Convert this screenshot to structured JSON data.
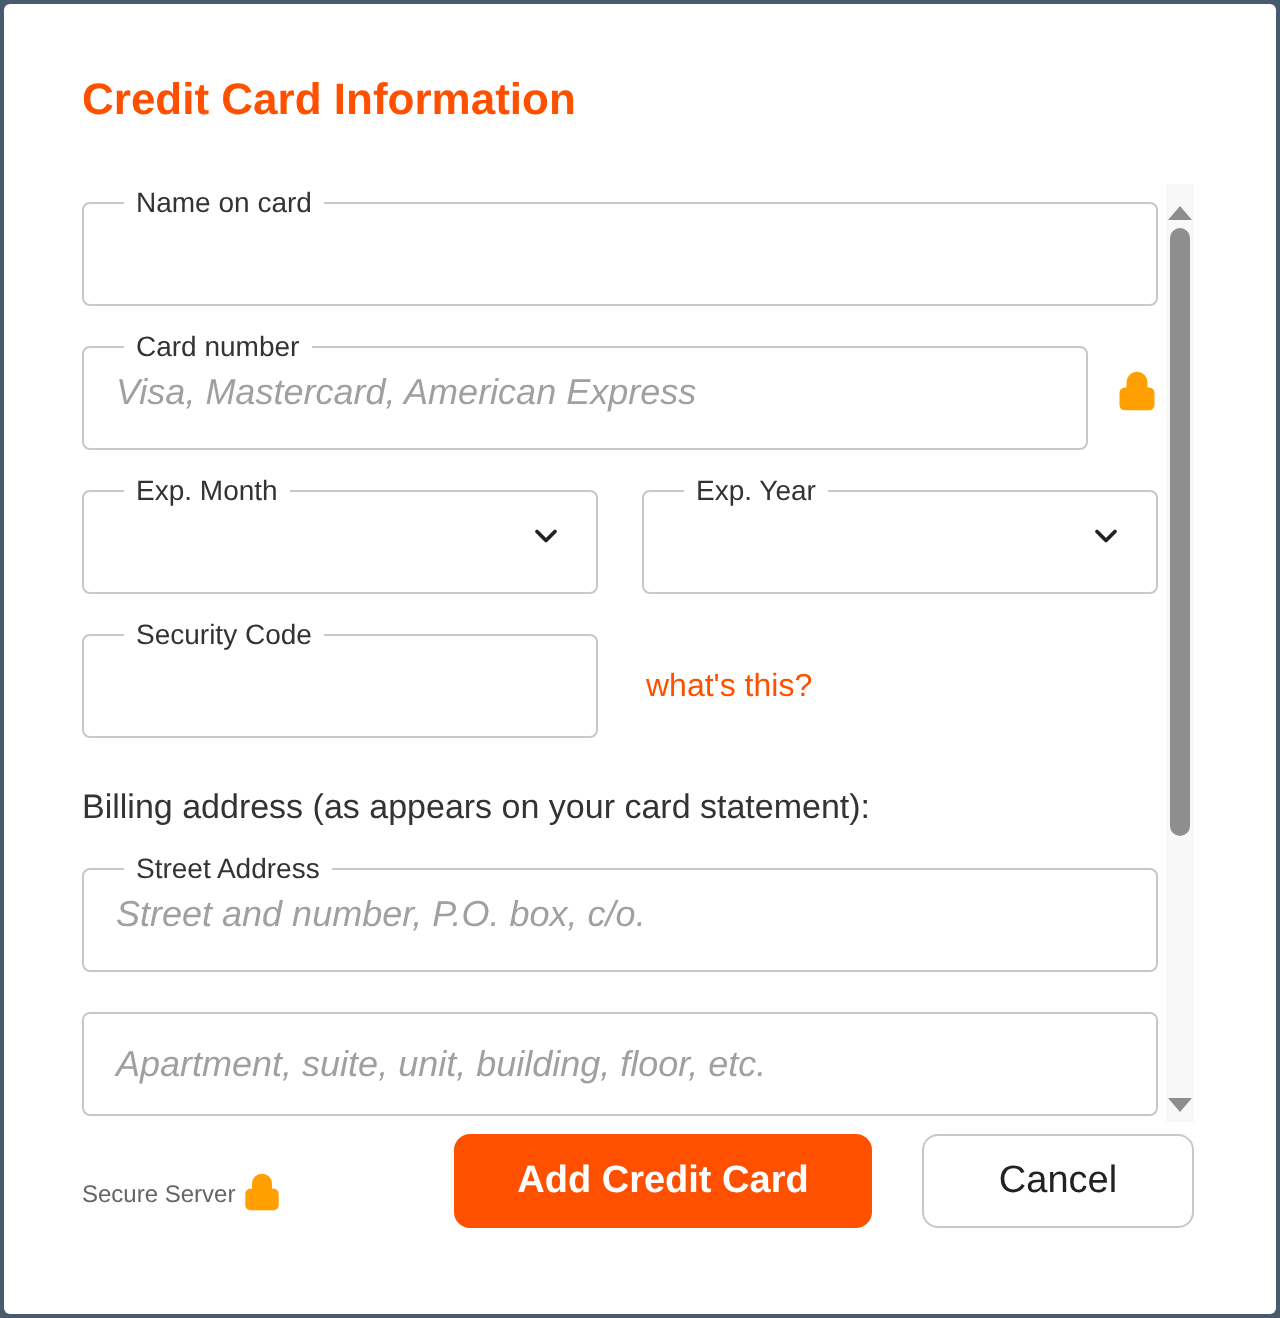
{
  "title": "Credit Card Information",
  "form": [
    {
      "kind": "field",
      "label": "Name on card"
    },
    {
      "kind": "field_lock",
      "label": "Card number",
      "placeholder": "Visa, Mastercard, American Express"
    },
    {
      "kind": "select_pair",
      "selects": [
        {
          "label": "Exp. Month"
        },
        {
          "label": "Exp. Year"
        }
      ]
    },
    {
      "kind": "field_link",
      "label": "Security Code",
      "link": "what's this?"
    },
    {
      "kind": "heading",
      "text": "Billing address (as appears on your card statement):"
    },
    {
      "kind": "field",
      "label": "Street Address",
      "placeholder": "Street and number, P.O. box, c/o."
    },
    {
      "kind": "field",
      "placeholder": "Apartment, suite, unit, building, floor, etc."
    }
  ],
  "secure_note": "Secure Server",
  "buttons": [
    {
      "kind": "primary",
      "label": "Add Credit Card"
    },
    {
      "kind": "secondary",
      "label": "Cancel"
    }
  ]
}
